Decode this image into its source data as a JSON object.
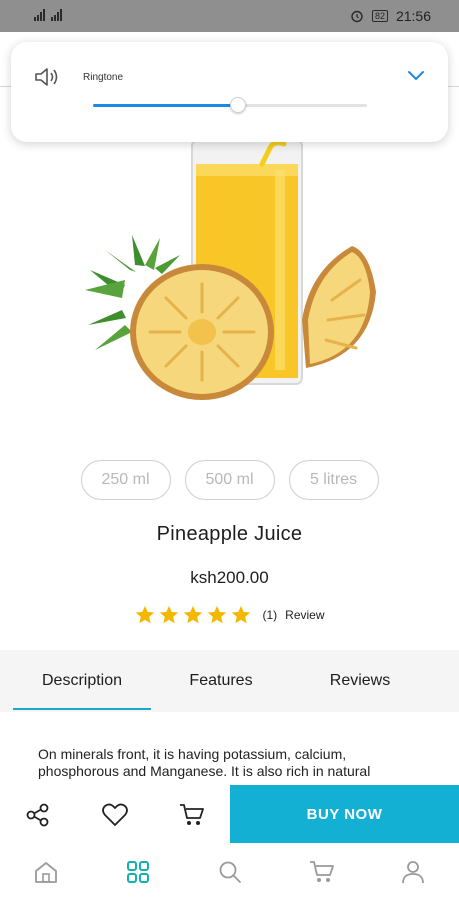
{
  "status_bar": {
    "time": "21:56",
    "battery": "82",
    "icons": [
      "signal-icon",
      "signal-icon",
      "alarm-icon",
      "battery-icon"
    ]
  },
  "volume_panel": {
    "label": "Ringtone",
    "level": 0.53,
    "icons": [
      "speaker-icon",
      "chevron-down-icon"
    ],
    "accent_color": "#1e88e5"
  },
  "product": {
    "image_alt": "pineapple-juice-image",
    "sizes": [
      "250 ml",
      "500 ml",
      "5 litres"
    ],
    "name": "Pineapple Juice",
    "price": "ksh200.00",
    "rating_stars": 5,
    "review_count": "(1)",
    "review_label": "Review"
  },
  "tabs": [
    {
      "label": "Description",
      "active": true
    },
    {
      "label": "Features",
      "active": false
    },
    {
      "label": "Reviews",
      "active": false
    }
  ],
  "description_text": "On minerals front, it is having potassium, calcium, phosphorous and Manganese. It is also rich in natural",
  "action_bar": {
    "icons": [
      "share-icon",
      "heart-icon",
      "cart-icon"
    ],
    "buy_label": "BUY NOW",
    "buy_color": "#14b0d3"
  },
  "bottom_nav": {
    "items": [
      "home-icon",
      "grid-icon",
      "search-icon",
      "cart-icon",
      "user-icon"
    ],
    "active": "grid-icon",
    "active_color": "#14b0b0"
  },
  "colors": {
    "accent": "#14b0d3",
    "star": "#f5b800",
    "tab_underline": "#1aa7cf"
  }
}
